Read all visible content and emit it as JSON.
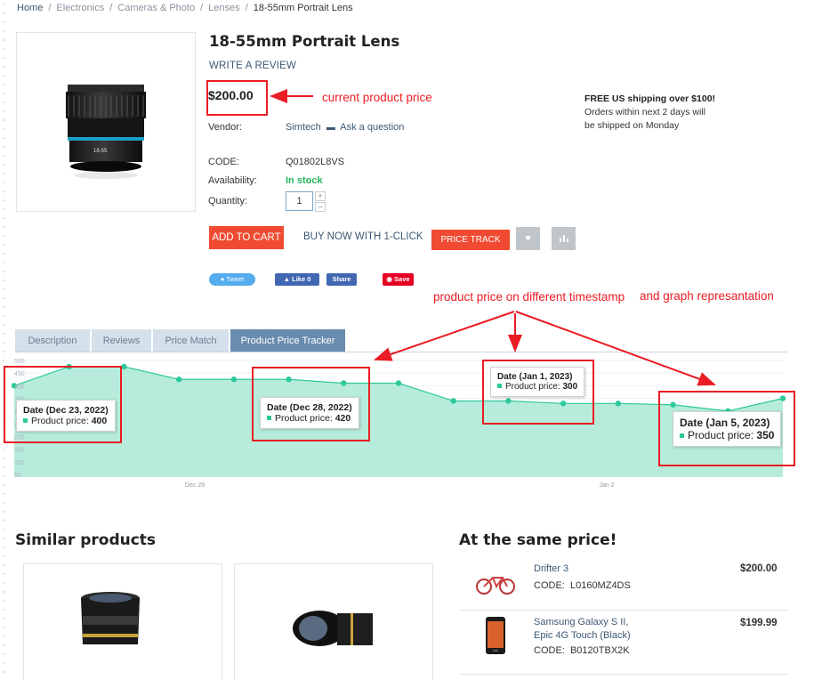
{
  "breadcrumb": {
    "items": [
      "Home",
      "Electronics",
      "Cameras & Photo",
      "Lenses"
    ],
    "current": "18-55mm Portrait Lens",
    "separator": "/"
  },
  "product": {
    "title": "18-55mm Portrait Lens",
    "write_review": "WRITE A REVIEW",
    "price": "$200.00",
    "vendor_label": "Vendor:",
    "vendor_name": "Simtech",
    "ask_question": "Ask a question",
    "code_label": "CODE:",
    "code_value": "Q01802L8VS",
    "availability_label": "Availability:",
    "availability_value": "In stock",
    "quantity_label": "Quantity:",
    "quantity_value": "1",
    "lens_marking": "18-55"
  },
  "shipping": {
    "headline": "FREE US shipping over $100!",
    "line1": "Orders within next 2 days will",
    "line2": "be shipped on Monday"
  },
  "actions": {
    "add_to_cart": "ADD TO CART",
    "buy_now": "BUY NOW WITH 1-CLICK",
    "price_track": "PRICE TRACK",
    "wishlist_icon": "heart-icon",
    "compare_icon": "compare-chart-icon"
  },
  "social": {
    "tweet": "Tweet",
    "fb_like": "Like 0",
    "fb_share": "Share",
    "pin_save": "Save"
  },
  "annotations": {
    "price_note": "current product price",
    "graph_note_a": "product price on different timestamp",
    "graph_note_b": "and graph represantation"
  },
  "tabs": [
    {
      "label": "Description"
    },
    {
      "label": "Reviews"
    },
    {
      "label": "Price Match"
    },
    {
      "label": "Product Price Tracker",
      "active": true
    }
  ],
  "chart_data": {
    "type": "area",
    "y_ticks": [
      "500",
      "450",
      "400",
      "350",
      "300",
      "250",
      "200",
      "150",
      "100",
      "50"
    ],
    "x_tick_labels": [
      "Dec 26",
      "Jan 2"
    ],
    "ylim": [
      40,
      510
    ],
    "series": [
      {
        "color": "#2ec99b",
        "fill": "#b7ecdc",
        "values": [
          400,
          475,
          475,
          425,
          425,
          425,
          410,
          410,
          340,
          340,
          330,
          330,
          325,
          300,
          350
        ]
      }
    ],
    "tooltips": [
      {
        "date": "Date (Dec 23, 2022)",
        "label": "Product price:",
        "value": "400"
      },
      {
        "date": "Date (Dec 28, 2022)",
        "label": "Product price:",
        "value": "420"
      },
      {
        "date": "Date (Jan 1, 2023)",
        "label": "Product price:",
        "value": "300"
      },
      {
        "date": "Date (Jan 5, 2023)",
        "label": "Product price:",
        "value": "350"
      }
    ]
  },
  "similar": {
    "title": "Similar products"
  },
  "same_price": {
    "title": "At the same price!",
    "items": [
      {
        "name_line1": "Drifter 3",
        "name_line2": "",
        "code_label": "CODE:",
        "code": "L0160MZ4DS",
        "price": "$200.00"
      },
      {
        "name_line1": "Samsung Galaxy S II,",
        "name_line2": "Epic 4G Touch (Black)",
        "code_label": "CODE:",
        "code": "B0120TBX2K",
        "price": "$199.99"
      }
    ]
  },
  "colors": {
    "accent_red": "#f04b32",
    "annotation_red": "#ea1c24",
    "chart_green": "#2ec99b",
    "link_blue": "#3d5873",
    "stock_green": "#24b35b"
  }
}
